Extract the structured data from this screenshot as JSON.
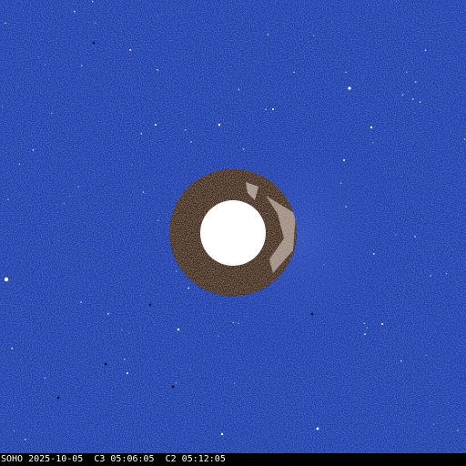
{
  "image": {
    "caption": "SOHO 2025-10-05  C3 05:06:05  C2 05:12:05",
    "colors": {
      "background": "#1c3fae",
      "c2_field": "#3a2418",
      "occulter": "#ffffff",
      "caption_bar": "#000000",
      "caption_text": "#ffffff"
    }
  }
}
